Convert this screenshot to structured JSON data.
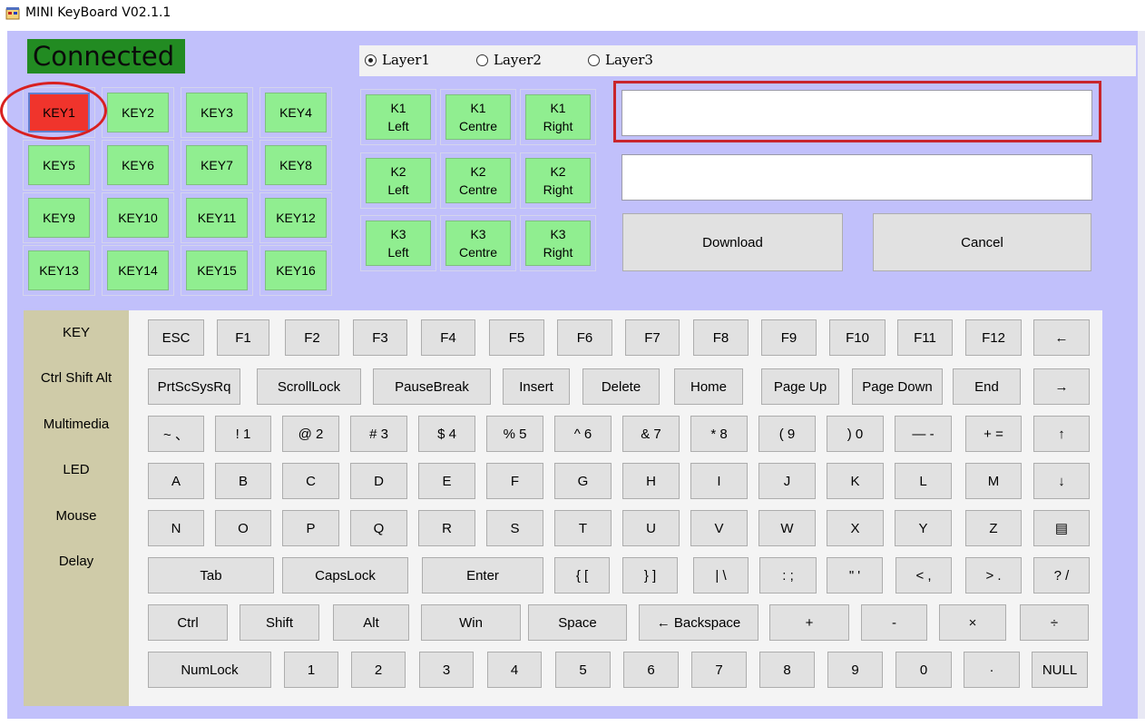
{
  "window": {
    "title": "MINI KeyBoard V02.1.1",
    "icon": "app-window-icon"
  },
  "status": {
    "text": "Connected",
    "color": "#228b22"
  },
  "keys": [
    "KEY1",
    "KEY2",
    "KEY3",
    "KEY4",
    "KEY5",
    "KEY6",
    "KEY7",
    "KEY8",
    "KEY9",
    "KEY10",
    "KEY11",
    "KEY12",
    "KEY13",
    "KEY14",
    "KEY15",
    "KEY16"
  ],
  "selected_key": "KEY1",
  "layers": [
    {
      "label": "Layer1",
      "checked": true
    },
    {
      "label": "Layer2",
      "checked": false
    },
    {
      "label": "Layer3",
      "checked": false
    }
  ],
  "knobs": [
    [
      "K1",
      "Left"
    ],
    [
      "K1",
      "Centre"
    ],
    [
      "K1",
      "Right"
    ],
    [
      "K2",
      "Left"
    ],
    [
      "K2",
      "Centre"
    ],
    [
      "K2",
      "Right"
    ],
    [
      "K3",
      "Left"
    ],
    [
      "K3",
      "Centre"
    ],
    [
      "K3",
      "Right"
    ]
  ],
  "inputs": {
    "primary_value": "",
    "secondary_value": ""
  },
  "buttons": {
    "download": "Download",
    "cancel": "Cancel"
  },
  "categories": [
    "KEY",
    "Ctrl Shift Alt",
    "Multimedia",
    "LED",
    "Mouse",
    "Delay"
  ],
  "keyboard_rows": [
    [
      "ESC",
      "F1",
      "F2",
      "F3",
      "F4",
      "F5",
      "F6",
      "F7",
      "F8",
      "F9",
      "F10",
      "F11",
      "F12",
      "←"
    ],
    [
      "PrtScSysRq",
      "ScrollLock",
      "PauseBreak",
      "Insert",
      "Delete",
      "Home",
      "Page Up",
      "Page Down",
      "End",
      "→"
    ],
    [
      "~ 、",
      "! 1",
      "@ 2",
      "# 3",
      "$ 4",
      "% 5",
      "^ 6",
      "& 7",
      "* 8",
      "( 9",
      ") 0",
      "— -",
      "+ =",
      "↑"
    ],
    [
      "A",
      "B",
      "C",
      "D",
      "E",
      "F",
      "G",
      "H",
      "I",
      "J",
      "K",
      "L",
      "M",
      "↓"
    ],
    [
      "N",
      "O",
      "P",
      "Q",
      "R",
      "S",
      "T",
      "U",
      "V",
      "W",
      "X",
      "Y",
      "Z",
      "▤"
    ],
    [
      "Tab",
      "CapsLock",
      "Enter",
      "{ [",
      "} ]",
      "| \\",
      ": ;",
      "\" '",
      "< ,",
      "> .",
      "? /"
    ],
    [
      "Ctrl",
      "Shift",
      "Alt",
      "Win",
      "Space",
      "← Backspace",
      "+",
      "-",
      "×",
      "÷"
    ],
    [
      "NumLock",
      "1",
      "2",
      "3",
      "4",
      "5",
      "6",
      "7",
      "8",
      "9",
      "0",
      "·",
      "NULL"
    ]
  ],
  "colors": {
    "background": "#c1c0fb",
    "key_green": "#90ee90",
    "key_selected": "#f0342c",
    "highlight_red": "#c8252c"
  }
}
